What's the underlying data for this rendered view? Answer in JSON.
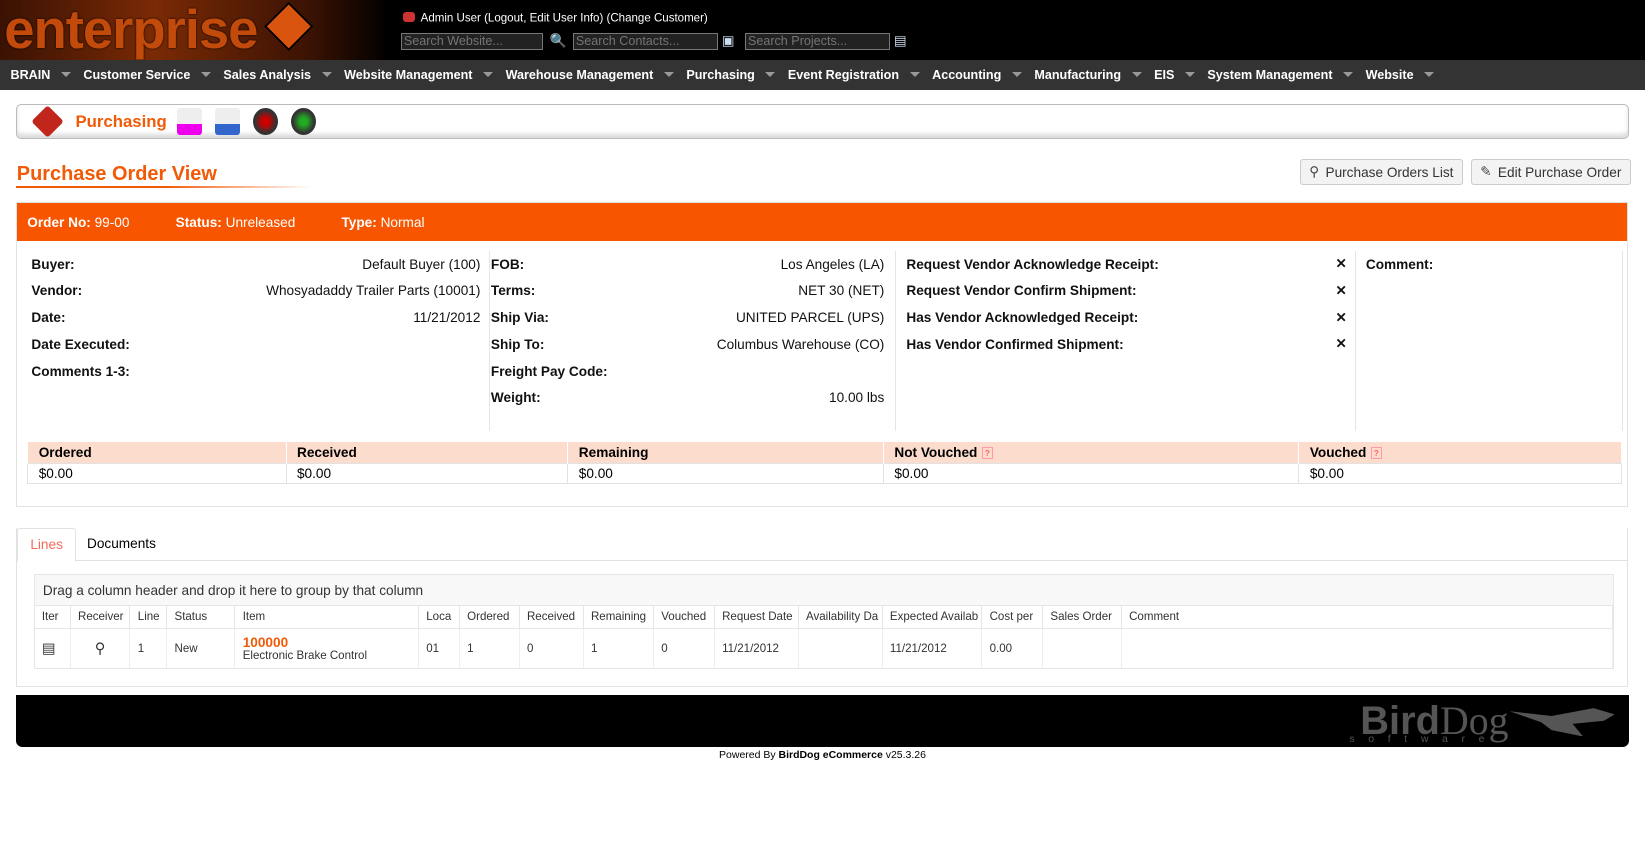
{
  "header": {
    "logo_text": "enterprise",
    "user_text": "Admin User (Logout, Edit User Info) (Change Customer)",
    "search_website_placeholder": "Search Website...",
    "search_contacts_placeholder": "Search Contacts...",
    "search_projects_placeholder": "Search Projects..."
  },
  "nav": [
    "BRAIN",
    "Customer Service",
    "Sales Analysis",
    "Website Management",
    "Warehouse Management",
    "Purchasing",
    "Event Registration",
    "Accounting",
    "Manufacturing",
    "EIS",
    "System Management",
    "Website"
  ],
  "module": {
    "title": "Purchasing"
  },
  "page": {
    "title": "Purchase Order View",
    "list_button": "Purchase Orders List",
    "edit_button": "Edit Purchase Order"
  },
  "order": {
    "order_no_label": "Order No:",
    "order_no": "99-00",
    "status_label": "Status:",
    "status": "Unreleased",
    "type_label": "Type:",
    "type": "Normal"
  },
  "col1": [
    {
      "k": "Buyer:",
      "v": "Default Buyer (100)"
    },
    {
      "k": "Vendor:",
      "v": "Whosyadaddy Trailer Parts (10001)"
    },
    {
      "k": "Date:",
      "v": "11/21/2012"
    },
    {
      "k": "Date Executed:",
      "v": ""
    },
    {
      "k": "Comments 1-3:",
      "v": ""
    }
  ],
  "col2": [
    {
      "k": "FOB:",
      "v": "Los Angeles (LA)"
    },
    {
      "k": "Terms:",
      "v": "NET 30 (NET)"
    },
    {
      "k": "Ship Via:",
      "v": "UNITED PARCEL (UPS)"
    },
    {
      "k": "Ship To:",
      "v": "Columbus Warehouse (CO)"
    },
    {
      "k": "Freight Pay Code:",
      "v": ""
    },
    {
      "k": "Weight:",
      "v": "10.00 lbs"
    }
  ],
  "col3": [
    {
      "k": "Request Vendor Acknowledge Receipt:",
      "v": "✕"
    },
    {
      "k": "Request Vendor Confirm Shipment:",
      "v": "✕"
    },
    {
      "k": "Has Vendor Acknowledged Receipt:",
      "v": "✕"
    },
    {
      "k": "Has Vendor Confirmed Shipment:",
      "v": "✕"
    }
  ],
  "comment_label": "Comment:",
  "summary": {
    "headers": [
      "Ordered",
      "Received",
      "Remaining",
      "Not Vouched",
      "Vouched"
    ],
    "values": [
      "$0.00",
      "$0.00",
      "$0.00",
      "$0.00",
      "$0.00"
    ]
  },
  "tabs": [
    "Lines",
    "Documents"
  ],
  "grid": {
    "group_hint": "Drag a column header and drop it here to group by that column",
    "columns": [
      "Iter",
      "Receiver",
      "Line",
      "Status",
      "Item",
      "Loca",
      "Ordered",
      "Received",
      "Remaining",
      "Vouched",
      "Request Date",
      "Availability Da",
      "Expected Availab",
      "Cost per",
      "Sales Order",
      "Comment"
    ],
    "row": {
      "line": "1",
      "status": "New",
      "item": "100000",
      "item_desc": "Electronic Brake Control",
      "loca": "01",
      "ordered": "1",
      "received": "0",
      "remaining": "1",
      "vouched": "0",
      "request_date": "11/21/2012",
      "availability": "",
      "expected": "11/21/2012",
      "cost": "0.00",
      "sales_order": "",
      "comment": ""
    }
  },
  "footer": {
    "logo": "BirdDog software",
    "powered_prefix": "Powered By ",
    "powered_brand": "BirdDog eCommerce",
    "version": " v25.3.26"
  },
  "colors": {
    "accent": "#f75500",
    "summary_header": "#fcdccd"
  }
}
